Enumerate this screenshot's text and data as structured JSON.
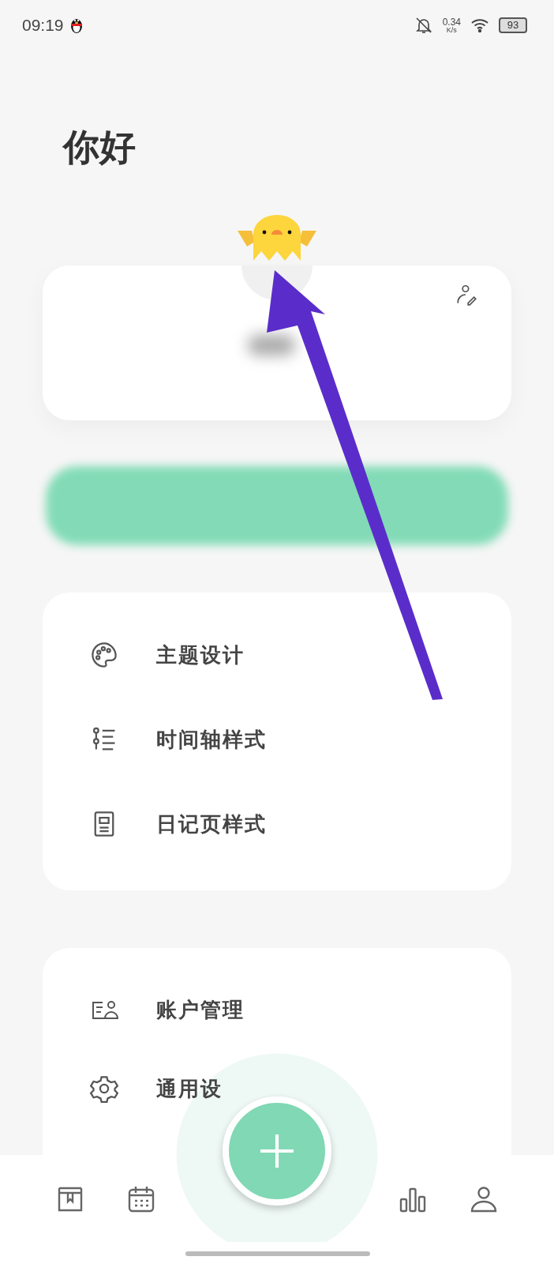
{
  "status_bar": {
    "time": "09:19",
    "net_speed": "0.34",
    "net_unit": "K/s",
    "battery": "93"
  },
  "greeting": "你好",
  "theme_menu": [
    {
      "kind": "palette",
      "label": "主题设计"
    },
    {
      "kind": "timeline",
      "label": "时间轴样式"
    },
    {
      "kind": "page",
      "label": "日记页样式"
    }
  ],
  "account_menu": [
    {
      "kind": "account",
      "label": "账户管理"
    },
    {
      "kind": "gear",
      "label": "通用设"
    }
  ],
  "bottom_nav": [
    {
      "kind": "book"
    },
    {
      "kind": "calendar"
    },
    {
      "kind": "stats"
    },
    {
      "kind": "profile"
    }
  ]
}
